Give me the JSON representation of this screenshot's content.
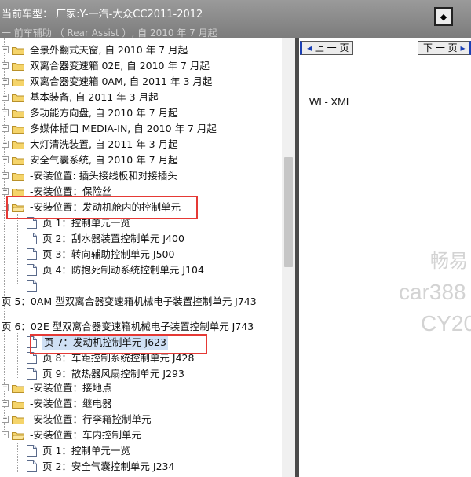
{
  "header": {
    "title": "当前车型：  厂家:Y-一汽-大众CC2011-2012",
    "overlap_text": "一 前车辅助 （ Rear Assist ）, 自 2010 年 7 月起",
    "collapse_icon": "collapse-panel-icon"
  },
  "tree": {
    "folders": [
      {
        "label": "全景外翻式天窗, 自 2010 年 7 月起",
        "expander": "+"
      },
      {
        "label": "双离合器变速箱 02E, 自 2010 年 7 月起",
        "expander": "+"
      },
      {
        "label": "双离合器变速箱 0AM, 自 2011 年 3 月起",
        "expander": "+"
      },
      {
        "label": "基本装备, 自 2011 年 3 月起",
        "expander": "+"
      },
      {
        "label": "多功能方向盘, 自 2010 年 7 月起",
        "expander": "+"
      },
      {
        "label": "多媒体插口 MEDIA-IN, 自 2010 年 7 月起",
        "expander": "+"
      },
      {
        "label": "大灯清洗装置, 自 2011 年 3 月起",
        "expander": "+"
      },
      {
        "label": "安全气囊系统, 自 2010 年 7 月起",
        "expander": "+"
      },
      {
        "label": "-安装位置: 插头接线板和对接插头",
        "expander": "+"
      },
      {
        "label": "-安装位置：保险丝",
        "expander": "+"
      },
      {
        "label": "-安装位置：发动机舱内的控制单元",
        "expander": "-"
      }
    ],
    "engine_bay_pages": [
      "页 1：控制单元一览",
      "页 2：刮水器装置控制单元 J400",
      "页 3：转向辅助控制单元 J500",
      "页 4：防抱死制动系统控制单元 J104",
      ""
    ],
    "page5": "页 5：0AM 型双离合器变速箱机械电子装置控制单元 J743",
    "page6": "页 6：02E 型双离合器变速箱机械电子装置控制单元 J743",
    "pages_7_9": [
      "页 7：发动机控制单元 J623",
      "页 8：车距控制系统控制单元 J428",
      "页 9：散热器风扇控制单元 J293"
    ],
    "folders2": [
      {
        "label": "-安装位置：接地点",
        "expander": "+"
      },
      {
        "label": "-安装位置：继电器",
        "expander": "+"
      },
      {
        "label": "-安装位置：行李箱控制单元",
        "expander": "+"
      },
      {
        "label": "-安装位置：车内控制单元",
        "expander": "-"
      }
    ],
    "cabin_pages": [
      "页 1：控制单元一览",
      "页 2：安全气囊控制单元 J234"
    ]
  },
  "content": {
    "prev_label": "上 一 页",
    "next_label": "下 一 页",
    "doc_type": "WI - XML"
  },
  "watermark": {
    "line1": "畅易",
    "line2": "car388",
    "line3": "CY20"
  },
  "colors": {
    "highlight": "#e53935",
    "header_bg": "#8a8a8a",
    "selected": "#cfe0f5",
    "nav_accent": "#1a3fb5"
  }
}
